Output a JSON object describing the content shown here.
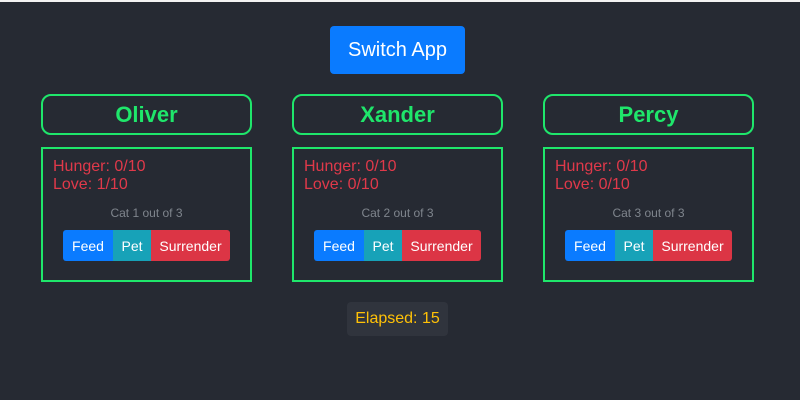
{
  "header": {
    "switch_label": "Switch App"
  },
  "cats": [
    {
      "name": "Oliver",
      "hunger": "Hunger: 0/10",
      "love": "Love: 1/10",
      "index_text": "Cat 1 out of 3",
      "feed_label": "Feed",
      "pet_label": "Pet",
      "surrender_label": "Surrender"
    },
    {
      "name": "Xander",
      "hunger": "Hunger: 0/10",
      "love": "Love: 0/10",
      "index_text": "Cat 2 out of 3",
      "feed_label": "Feed",
      "pet_label": "Pet",
      "surrender_label": "Surrender"
    },
    {
      "name": "Percy",
      "hunger": "Hunger: 0/10",
      "love": "Love: 0/10",
      "index_text": "Cat 3 out of 3",
      "feed_label": "Feed",
      "pet_label": "Pet",
      "surrender_label": "Surrender"
    }
  ],
  "footer": {
    "elapsed_text": "Elapsed: 15"
  },
  "colors": {
    "background": "#262a33",
    "accent_green": "#1fe66b",
    "stat_red": "#e0394a",
    "primary_blue": "#0a7bff",
    "info_teal": "#17a2b8",
    "danger_red": "#dc3545",
    "elapsed_yellow": "#ffc107"
  }
}
